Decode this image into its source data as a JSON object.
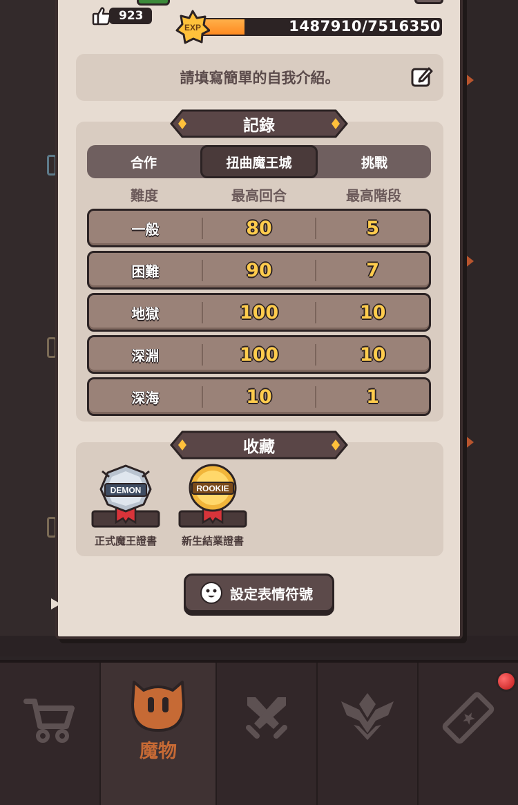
{
  "profile": {
    "likes": "923",
    "exp": {
      "badge": "EXP",
      "current": 1487910,
      "max": 7516350,
      "text": "1487910/7516350",
      "fill_color": "#ff8a1f"
    },
    "intro_placeholder": "請填寫簡單的自我介紹。"
  },
  "records": {
    "title": "記錄",
    "tabs": [
      {
        "label": "合作",
        "active": false
      },
      {
        "label": "扭曲魔王城",
        "active": true
      },
      {
        "label": "挑戰",
        "active": false
      }
    ],
    "columns": [
      "難度",
      "最高回合",
      "最高階段"
    ],
    "rows": [
      {
        "difficulty": "一般",
        "max_round": "80",
        "max_stage": "5"
      },
      {
        "difficulty": "困難",
        "max_round": "90",
        "max_stage": "7"
      },
      {
        "difficulty": "地獄",
        "max_round": "100",
        "max_stage": "10"
      },
      {
        "difficulty": "深淵",
        "max_round": "100",
        "max_stage": "10"
      },
      {
        "difficulty": "深海",
        "max_round": "10",
        "max_stage": "1"
      }
    ]
  },
  "collection": {
    "title": "收藏",
    "items": [
      {
        "emblem": "DEMON",
        "name": "正式魔王證書"
      },
      {
        "emblem": "ROOKIE",
        "name": "新生結業證書"
      }
    ]
  },
  "emote_button": {
    "label": "設定表情符號"
  },
  "bottom_nav": {
    "items": [
      {
        "icon": "cart-icon",
        "label": ""
      },
      {
        "icon": "monster-icon",
        "label": "魔物",
        "active": true
      },
      {
        "icon": "swords-icon",
        "label": ""
      },
      {
        "icon": "rank-wings-icon",
        "label": ""
      },
      {
        "icon": "ticket-icon",
        "label": "",
        "notification": true
      }
    ]
  },
  "colors": {
    "accent": "#c66a35",
    "gold": "#ffcc4d",
    "panel": "#e7dcd2",
    "dark": "#2c2324"
  }
}
